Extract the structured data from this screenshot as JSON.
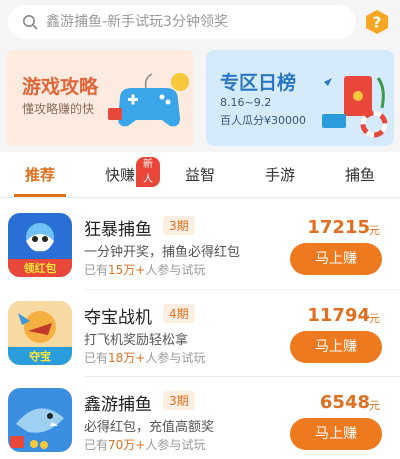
{
  "search": {
    "placeholder": "鑫游捕鱼-新手试玩3分钟领奖"
  },
  "banners": {
    "left": {
      "title": "游戏攻略",
      "subtitle": "懂攻略赚的快"
    },
    "right": {
      "title": "专区日榜",
      "dates": "8.16~9.2",
      "prize": "百人瓜分¥30000"
    }
  },
  "tabs": [
    {
      "label": "推荐",
      "active": true
    },
    {
      "label": "快赚",
      "badge": "新人"
    },
    {
      "label": "益智"
    },
    {
      "label": "手游"
    },
    {
      "label": "捕鱼"
    }
  ],
  "games": [
    {
      "name": "狂暴捕鱼",
      "period": "3期",
      "desc": "一分钟开奖，捕鱼必得红包",
      "stat_prefix": "已有",
      "stat_count": "15万+",
      "stat_suffix": "人参与试玩",
      "amount": "17215",
      "unit": "元",
      "button": "马上赚",
      "thumb_text": "领红包"
    },
    {
      "name": "夺宝战机",
      "period": "4期",
      "desc": "打飞机奖励轻松拿",
      "stat_prefix": "已有",
      "stat_count": "18万+",
      "stat_suffix": "人参与试玩",
      "amount": "11794",
      "unit": "元",
      "button": "马上赚",
      "thumb_text": "夺宝"
    },
    {
      "name": "鑫游捕鱼",
      "period": "3期",
      "desc": "必得红包，充值高额奖",
      "stat_prefix": "已有",
      "stat_count": "70万+",
      "stat_suffix": "人参与试玩",
      "amount": "6548",
      "unit": "元",
      "button": "马上赚"
    }
  ],
  "colors": {
    "accent": "#e07020",
    "button": "#ee7a1f",
    "badge": "#e8473a"
  }
}
